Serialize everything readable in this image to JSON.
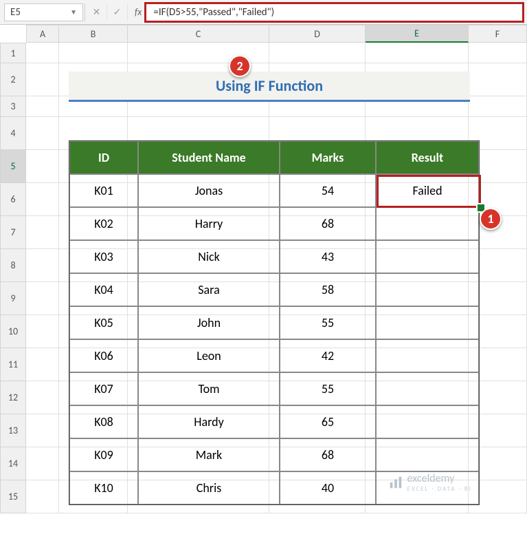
{
  "nameBox": "E5",
  "formula": "=IF(D5>55,\"Passed\",\"Failed\")",
  "title": "Using IF Function",
  "columnHeaders": [
    "A",
    "B",
    "C",
    "D",
    "E",
    "F"
  ],
  "rowNumbers": [
    "1",
    "2",
    "3",
    "4",
    "5",
    "6",
    "7",
    "8",
    "9",
    "10",
    "11",
    "12",
    "13",
    "14",
    "15"
  ],
  "tableHeaders": {
    "id": "ID",
    "name": "Student Name",
    "marks": "Marks",
    "result": "Result"
  },
  "rows": [
    {
      "id": "K01",
      "name": "Jonas",
      "marks": "54",
      "result": "Failed"
    },
    {
      "id": "K02",
      "name": "Harry",
      "marks": "68",
      "result": ""
    },
    {
      "id": "K03",
      "name": "Nick",
      "marks": "43",
      "result": ""
    },
    {
      "id": "K04",
      "name": "Sara",
      "marks": "58",
      "result": ""
    },
    {
      "id": "K05",
      "name": "John",
      "marks": "55",
      "result": ""
    },
    {
      "id": "K06",
      "name": "Leon",
      "marks": "42",
      "result": ""
    },
    {
      "id": "K07",
      "name": "Tom",
      "marks": "55",
      "result": ""
    },
    {
      "id": "K08",
      "name": "Hardy",
      "marks": "65",
      "result": ""
    },
    {
      "id": "K09",
      "name": "Mark",
      "marks": "68",
      "result": ""
    },
    {
      "id": "K10",
      "name": "Chris",
      "marks": "40",
      "result": ""
    }
  ],
  "callouts": {
    "c1": "1",
    "c2": "2"
  },
  "watermark": {
    "brand": "exceldemy",
    "tag": "EXCEL · DATA · BI"
  }
}
